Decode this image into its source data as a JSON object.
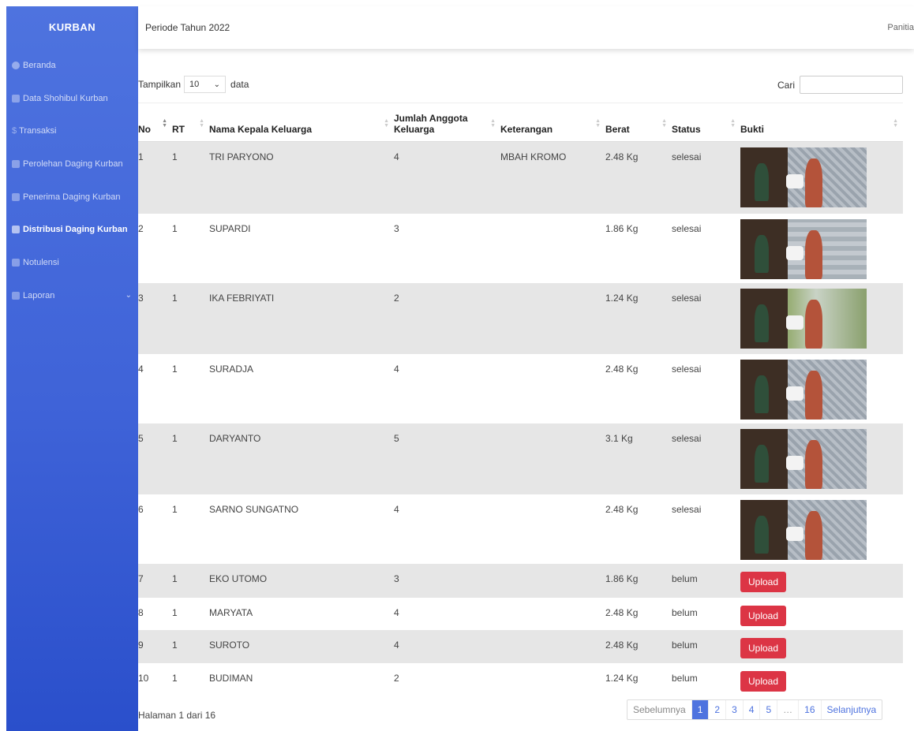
{
  "sidebar": {
    "brand": "KURBAN",
    "items": [
      {
        "label": "Beranda",
        "icon": "dashboard-icon"
      },
      {
        "label": "Data Shohibul Kurban",
        "icon": "users-icon"
      },
      {
        "label": "Transaksi",
        "icon": "dollar-icon"
      },
      {
        "label": "Perolehan Daging Kurban",
        "icon": "table-icon"
      },
      {
        "label": "Penerima Daging Kurban",
        "icon": "people-icon"
      },
      {
        "label": "Distribusi Daging Kurban",
        "icon": "car-icon"
      },
      {
        "label": "Notulensi",
        "icon": "save-icon"
      },
      {
        "label": "Laporan",
        "icon": "report-icon"
      }
    ]
  },
  "topbar": {
    "period": "Periode Tahun 2022",
    "user": "Panitia"
  },
  "controls": {
    "show_prefix": "Tampilkan",
    "show_value": "10",
    "show_suffix": "data",
    "search_label": "Cari",
    "search_value": ""
  },
  "table": {
    "headers": [
      "No",
      "RT",
      "Nama Kepala Keluarga",
      "Jumlah Anggota Keluarga",
      "Keterangan",
      "Berat",
      "Status",
      "Bukti"
    ],
    "rows": [
      {
        "no": "1",
        "rt": "1",
        "nama": "TRI PARYONO",
        "jumlah": "4",
        "ket": "MBAH KROMO",
        "berat": "2.48 Kg",
        "status": "selesai"
      },
      {
        "no": "2",
        "rt": "1",
        "nama": "SUPARDI",
        "jumlah": "3",
        "ket": "",
        "berat": "1.86 Kg",
        "status": "selesai"
      },
      {
        "no": "3",
        "rt": "1",
        "nama": "IKA FEBRIYATI",
        "jumlah": "2",
        "ket": "",
        "berat": "1.24 Kg",
        "status": "selesai"
      },
      {
        "no": "4",
        "rt": "1",
        "nama": "SURADJA",
        "jumlah": "4",
        "ket": "",
        "berat": "2.48 Kg",
        "status": "selesai"
      },
      {
        "no": "5",
        "rt": "1",
        "nama": "DARYANTO",
        "jumlah": "5",
        "ket": "",
        "berat": "3.1 Kg",
        "status": "selesai"
      },
      {
        "no": "6",
        "rt": "1",
        "nama": "SARNO SUNGATNO",
        "jumlah": "4",
        "ket": "",
        "berat": "2.48 Kg",
        "status": "selesai"
      },
      {
        "no": "7",
        "rt": "1",
        "nama": "EKO UTOMO",
        "jumlah": "3",
        "ket": "",
        "berat": "1.86 Kg",
        "status": "belum"
      },
      {
        "no": "8",
        "rt": "1",
        "nama": "MARYATA",
        "jumlah": "4",
        "ket": "",
        "berat": "2.48 Kg",
        "status": "belum"
      },
      {
        "no": "9",
        "rt": "1",
        "nama": "SUROTO",
        "jumlah": "4",
        "ket": "",
        "berat": "2.48 Kg",
        "status": "belum"
      },
      {
        "no": "10",
        "rt": "1",
        "nama": "BUDIMAN",
        "jumlah": "2",
        "ket": "",
        "berat": "1.24 Kg",
        "status": "belum"
      }
    ],
    "upload_label": "Upload"
  },
  "footer": {
    "info": "Halaman 1 dari 16",
    "prev": "Sebelumnya",
    "pages": [
      "1",
      "2",
      "3",
      "4",
      "5",
      "…",
      "16"
    ],
    "next": "Selanjutnya"
  },
  "colors": {
    "sidebar": "#4e73df",
    "upload": "#dc3545",
    "active_page": "#4e73df"
  }
}
